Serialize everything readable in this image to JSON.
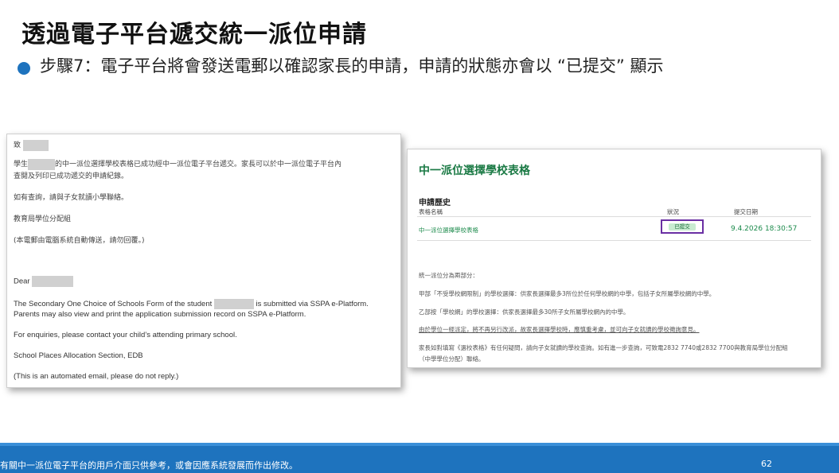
{
  "slide": {
    "title": "透過電子平台遞交統一派位申請",
    "bullet": "步驟7：電子平台將會發送電郵以確認家長的申請，申請的狀態亦會以 “已提交” 顯示",
    "footer_note": "有關中一派位電子平台的用戶介面只供參考，或會因應系統發展而作出修改。",
    "page_number": "62"
  },
  "email": {
    "greeting_zh": "致",
    "line1_prefix": "學生",
    "line1_rest": "的中一派位選擇學校表格已成功經中一派位電子平台遞交。家長可以於中一派位電子平台內",
    "line1_cont": "查閱及列印已成功遞交的申請紀錄。",
    "enquiry_zh": "如有查詢，請與子女就讀小學聯絡。",
    "signoff_zh": "教育局學位分配組",
    "auto_zh": "(本電郵由電腦系統自動傳送，請勿回覆。)",
    "greeting_en": "Dear",
    "body_en_1a": "The Secondary One Choice of Schools Form of the student",
    "body_en_1b": "is submitted via SSPA e-Platform.",
    "body_en_2": "Parents may also view and print the application submission record on SSPA e-Platform.",
    "enquiry_en": "For enquiries, please contact your child’s attending primary school.",
    "signoff_en": "School Places Allocation Section, EDB",
    "auto_en": "(This is an automated email, please do not reply.)"
  },
  "form": {
    "title": "中一派位選擇學校表格",
    "section": "申請歷史",
    "columns": [
      "表格名稱",
      "狀況",
      "提交日期"
    ],
    "row": {
      "name": "中一派位選擇學校表格",
      "status": "已提交",
      "date": "9.4.2026 18:30:57"
    },
    "notes": [
      "統一派位分為兩部分：",
      "甲部「不受學校網限制」的學校選擇：供家長選擇最多3所位於任何學校網的中學，包括子女所屬學校網的中學。",
      "乙部按「學校網」的學校選擇：供家長選擇最多30所子女所屬學校網內的中學。",
      "由於學位一經派定，將不再另行改派，故家長選擇學校時，應慎重考慮，並可向子女就讀的學校徵詢意見。",
      "家長如對填寫《選校表格》有任何疑問，請向子女就讀的學校查詢。如有進一步查詢，可致電2832 7740或2832 7700與教育局學位分配組",
      "（中學學位分配）聯絡。"
    ]
  },
  "colors": {
    "accent_blue": "#1e73be",
    "form_green": "#1b7a45",
    "highlight_purple": "#6a2fa3",
    "status_bg": "#c9ecd1"
  }
}
